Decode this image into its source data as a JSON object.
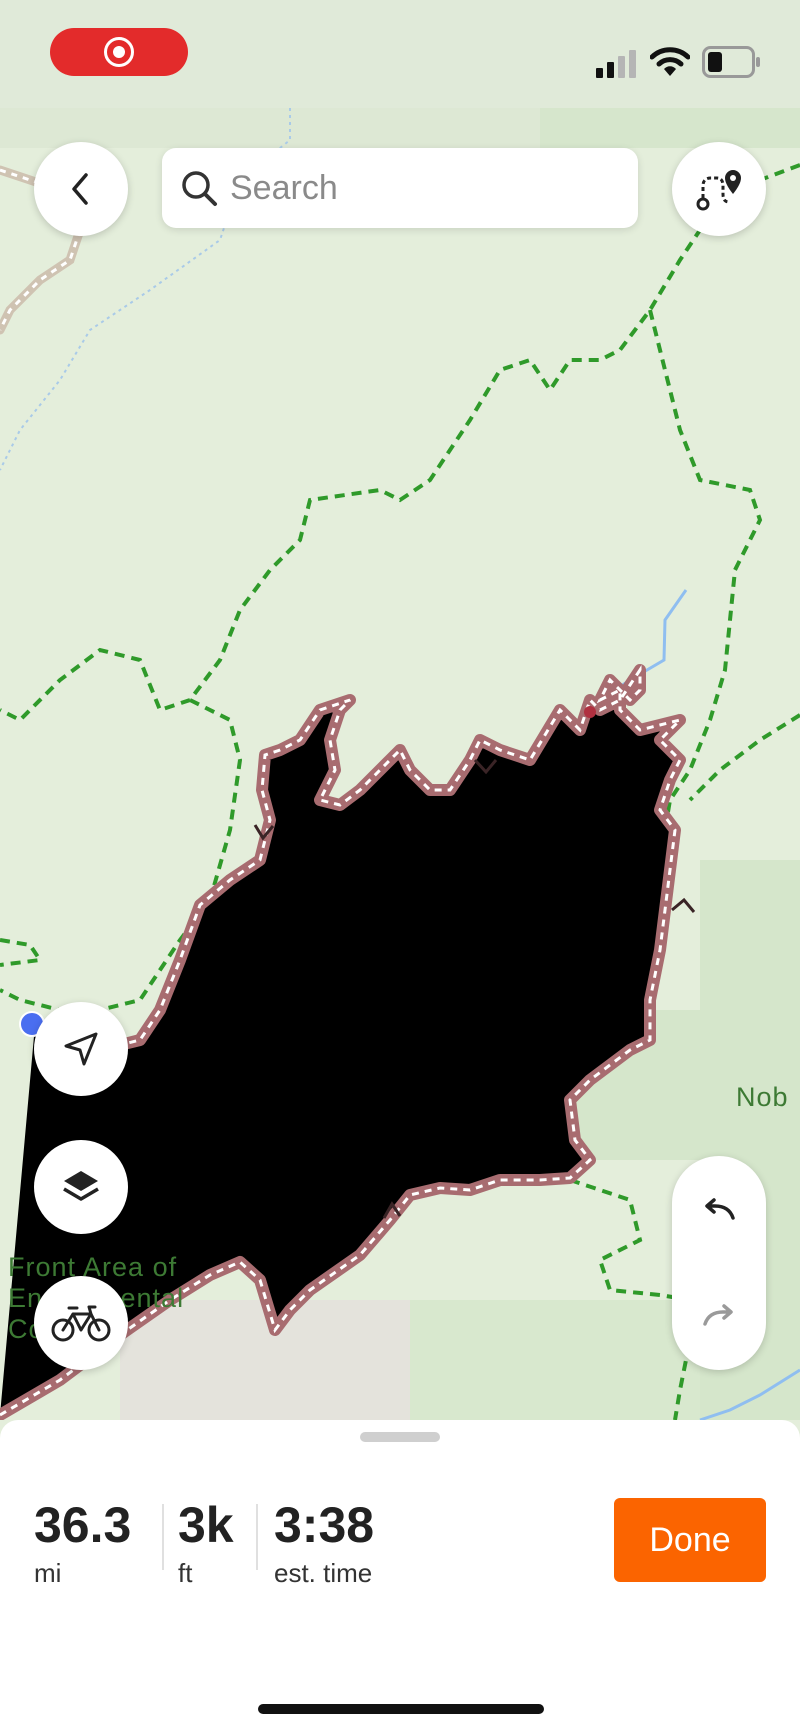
{
  "status_bar": {
    "recording": true,
    "battery_level": 0.3
  },
  "search": {
    "placeholder": "Search",
    "value": ""
  },
  "map": {
    "labels": {
      "front_area_line1": "Front Area of",
      "front_area_line2": "En",
      "front_area_line2b": "mental",
      "front_area_line3": "Co",
      "nob": "Nob"
    },
    "colors": {
      "route": "#a86c70",
      "trail": "#2f9a2a",
      "water": "#8fbef0",
      "land": "#e4eedb"
    }
  },
  "stats": {
    "distance": {
      "value": "36.3",
      "unit": "mi"
    },
    "elevation": {
      "value": "3k",
      "unit": "ft"
    },
    "time": {
      "value": "3:38",
      "unit": "est. time"
    }
  },
  "actions": {
    "done_label": "Done"
  },
  "icons": [
    "back-icon",
    "search-icon",
    "route-planner-icon",
    "locate-icon",
    "layers-icon",
    "bike-icon",
    "undo-icon",
    "redo-icon"
  ]
}
